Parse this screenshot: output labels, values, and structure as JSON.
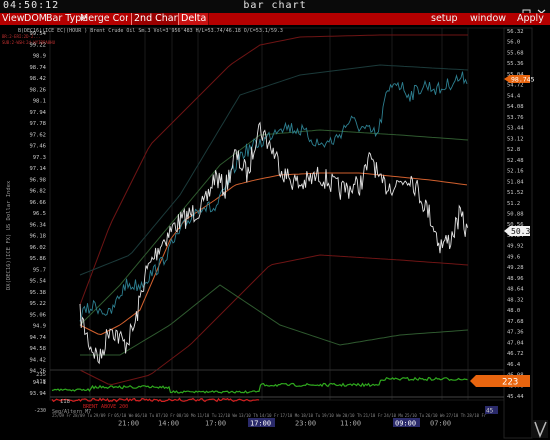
{
  "titlebar": {
    "clock": "04:50:12",
    "title": "bar chart",
    "window_buttons": [
      "minimize-icon",
      "maximize-icon",
      "close-icon"
    ]
  },
  "menubar": {
    "left_items": [
      "View",
      "DOM",
      "Bar Type",
      "Merge Contr"
    ],
    "tabs": [
      "2nd Chart",
      "Delta"
    ],
    "right_items": [
      "setup",
      "window",
      "Apply"
    ]
  },
  "chart": {
    "header_line": "B(DEC16)(ICE EC)(HOUR ) Brent Crude Oil  Sm.3 Vol=3'956'483 H/L=53.74/46.18 O/C=53.1/59.3",
    "small_red_lines": [
      "BR:2-ERI:2D-2...",
      "SUB:2-WSH:2d-WYIBPA8HU"
    ],
    "left_axis_vertical_label": "DX(DEC16)(ICE FX) US Dollar Index",
    "left_ticks": [
      "99.54",
      "99.22",
      "98.9",
      "98.58",
      "98.26",
      "97.94",
      "97.62",
      "97.3",
      "96.98",
      "96.66",
      "96.34",
      "96.02",
      "95.7",
      "95.38",
      "95.06",
      "94.74",
      "94.42",
      "94.1",
      "93.78"
    ],
    "left_ticks_positioned": [
      "99.54",
      "99.22",
      "98.9",
      "98.74",
      "98.42",
      "98.1",
      "97.78",
      "97.46",
      "97.14",
      "96.82",
      "96.5",
      "96.18",
      "95.86",
      "95.54",
      "95.22",
      "94.9",
      "94.58",
      "94.26"
    ],
    "right_ticks": [
      "56.32",
      "55.68",
      "55.04",
      "54.4",
      "53.76",
      "53.12",
      "52.48",
      "51.84",
      "51.2",
      "50.56",
      "49.92",
      "49.28",
      "48.64",
      "48.0",
      "47.36",
      "46.72",
      "46.08",
      "45.44"
    ],
    "right_tick_labels_shown": [
      "56.32",
      "56.0",
      "55.68",
      "55.36",
      "55.04",
      "54.72",
      "54.4",
      "54.08",
      "53.76",
      "53.44",
      "53.12",
      "52.8",
      "52.48",
      "52.16",
      "51.84",
      "51.52",
      "51.2",
      "50.88",
      "50.56",
      "50.24",
      "49.92",
      "49.6",
      "49.28",
      "48.96",
      "48.64",
      "48.32",
      "48.0",
      "47.68",
      "47.36",
      "47.04",
      "46.72",
      "46.4",
      "46.08",
      "45.76",
      "45.44"
    ],
    "left_tick_labels_shown": [
      "99.54",
      "99.22",
      "98.9",
      "98.74",
      "98.42",
      "98.26",
      "98.1",
      "97.94",
      "97.78",
      "97.62",
      "97.46",
      "97.3",
      "97.14",
      "96.98",
      "96.82",
      "96.66",
      "96.5",
      "96.34",
      "96.18",
      "96.02",
      "95.86",
      "95.7",
      "95.54",
      "95.38",
      "95.22",
      "95.06",
      "94.9",
      "94.74",
      "94.58",
      "94.42",
      "94.26",
      "94.1",
      "93.94"
    ],
    "price_badge": "50.3",
    "left_badge": "98.745",
    "indicator_badge": "223",
    "indicator_labels": [
      "235",
      "118",
      "118",
      "-200",
      "-230"
    ],
    "indicator_label_red": "BRENT ABOVE 200",
    "indicator_title": "Seg/Altern M7",
    "time_labels": [
      "25/09 Fr",
      "28/09 Tu",
      "29/09 Fr",
      "05/10 We",
      "06/10 Tu",
      "07/10 Fr",
      "08/10 Mo",
      "11/10 Tu",
      "12/10 We",
      "13/10 Th",
      "14/10 Fr",
      "17/10 Mo",
      "18/10 Tu",
      "19/10 We",
      "20/10 Th",
      "21/10 Fr",
      "24/10 Mo",
      "25/10 Tu",
      "26/10 We",
      "27/10 Th",
      "28/10 Fr"
    ],
    "hour_labels": [
      "21:00",
      "14:00",
      "17:00",
      "17:00",
      "23:00",
      "11:00",
      "09:00",
      "07:00"
    ],
    "hour_highlighted": [
      "17:00",
      "09:00"
    ],
    "bottom_right_badge": "45"
  },
  "chart_data": {
    "type": "line",
    "title": "",
    "series": [
      {
        "name": "Brent Crude Oil",
        "color": "#e0e0e0",
        "axis": "right"
      },
      {
        "name": "US Dollar Index",
        "color": "#2f7f8f",
        "axis": "left"
      }
    ],
    "price_last": 50.3,
    "indicator_last": 223,
    "right_axis_range": [
      45.44,
      56.32
    ],
    "left_axis_range": [
      93.94,
      99.54
    ],
    "grid": true
  }
}
